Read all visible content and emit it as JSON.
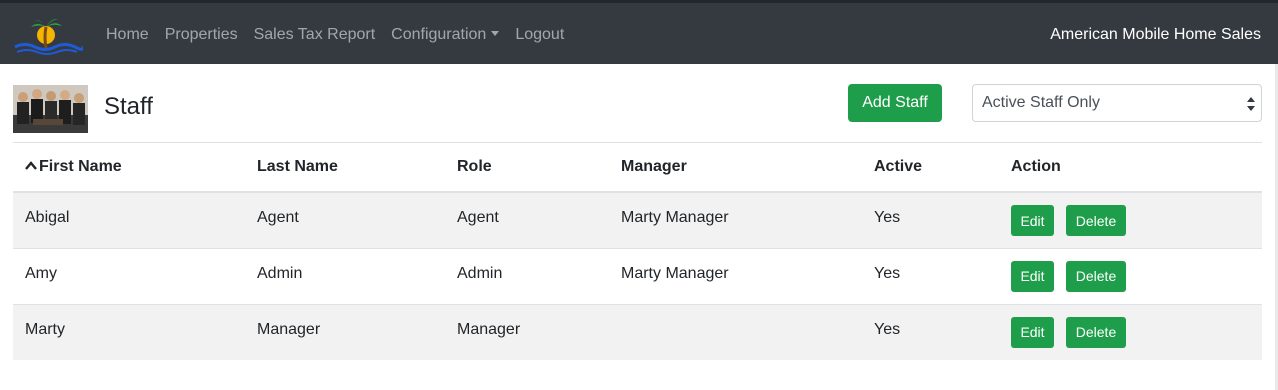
{
  "navbar": {
    "links": [
      {
        "label": "Home"
      },
      {
        "label": "Properties"
      },
      {
        "label": "Sales Tax Report"
      },
      {
        "label": "Configuration",
        "dropdown": true
      },
      {
        "label": "Logout"
      }
    ],
    "brand": "American Mobile Home Sales"
  },
  "page": {
    "title": "Staff",
    "add_button": "Add Staff",
    "filter": {
      "selected": "Active Staff Only"
    }
  },
  "table": {
    "columns": [
      "First Name",
      "Last Name",
      "Role",
      "Manager",
      "Active",
      "Action"
    ],
    "sorted_column": "First Name",
    "sort_direction": "ascending",
    "rows": [
      {
        "first": "Abigal",
        "last": "Agent",
        "role": "Agent",
        "manager": "Marty Manager",
        "active": "Yes"
      },
      {
        "first": "Amy",
        "last": "Admin",
        "role": "Admin",
        "manager": "Marty Manager",
        "active": "Yes"
      },
      {
        "first": "Marty",
        "last": "Manager",
        "role": "Manager",
        "manager": "",
        "active": "Yes"
      }
    ],
    "edit_label": "Edit",
    "delete_label": "Delete"
  },
  "colors": {
    "navbar": "#343a40",
    "accent_green": "#1e9e4a"
  },
  "icons": {
    "logo": "palm-tree-logo-icon",
    "sort": "caret-up-icon",
    "select": "select-arrows-icon"
  }
}
